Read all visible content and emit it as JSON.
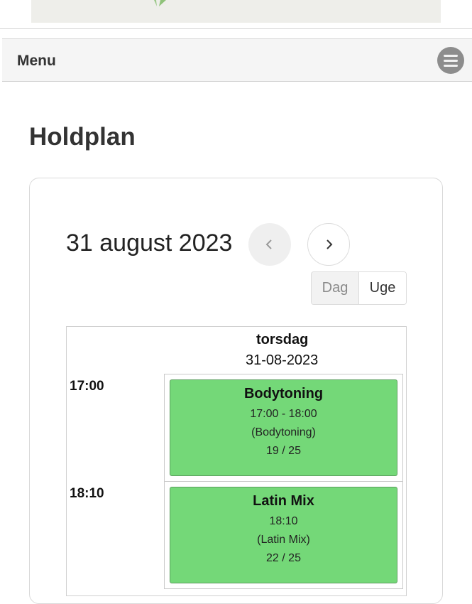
{
  "menu": {
    "label": "Menu",
    "icon": "hamburger-menu-icon"
  },
  "page": {
    "title": "Holdplan"
  },
  "calendar": {
    "current_date_label": "31 august 2023",
    "prev_icon": "chevron-left-icon",
    "next_icon": "chevron-right-icon",
    "views": {
      "day": "Dag",
      "week": "Uge",
      "selected": "Dag"
    },
    "column": {
      "day_name": "torsdag",
      "date": "31-08-2023"
    },
    "events": [
      {
        "time_label": "17:00",
        "title": "Bodytoning",
        "time_range": "17:00 - 18:00",
        "subtitle": "(Bodytoning)",
        "capacity": "19 / 25"
      },
      {
        "time_label": "18:10",
        "title": "Latin Mix",
        "time_range": "18:10",
        "subtitle": "(Latin Mix)",
        "capacity": "22 / 25"
      }
    ]
  },
  "colors": {
    "event_bg": "#74d878",
    "event_border": "#5b9e5e",
    "menubar_bg": "#f5f5f5"
  }
}
